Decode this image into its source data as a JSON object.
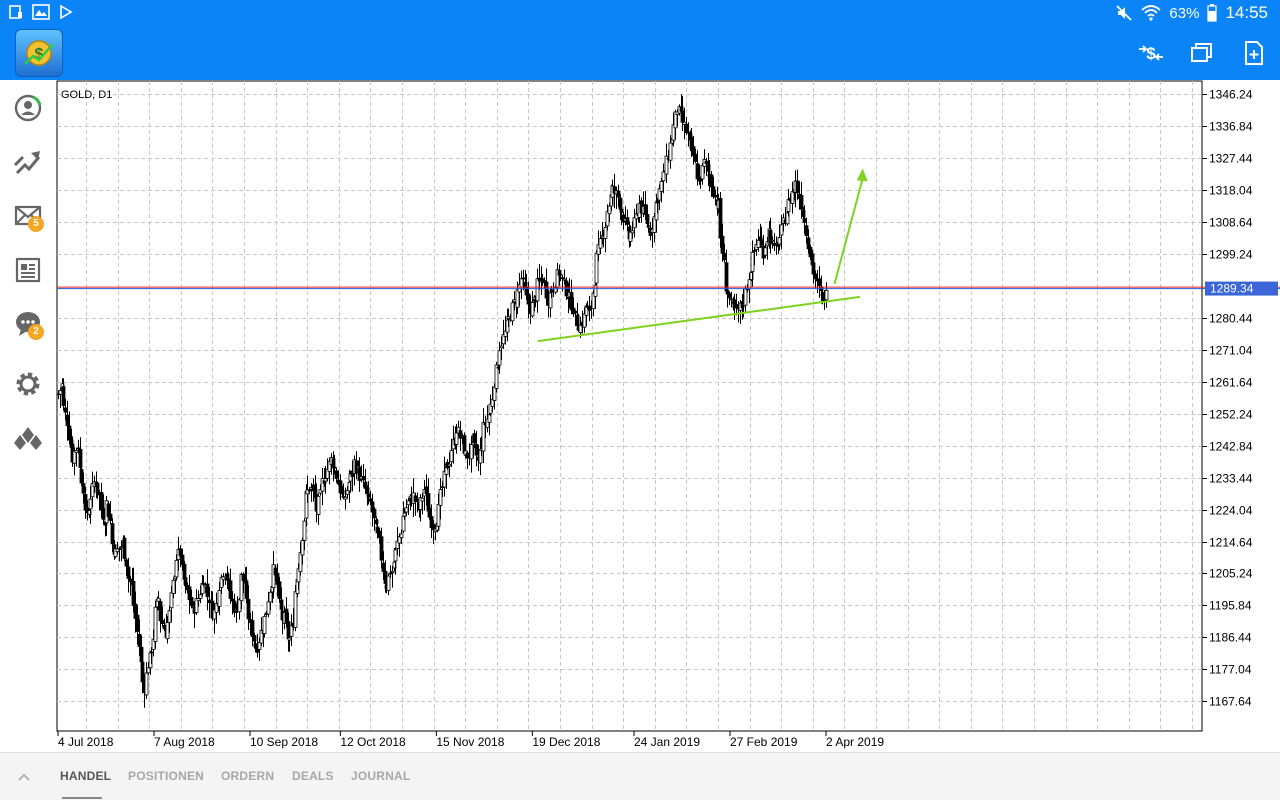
{
  "statusbar": {
    "battery": "63%",
    "time": "14:55"
  },
  "sidebar": {
    "mail_badge": "5",
    "chat_badge": "2"
  },
  "chart": {
    "symbol_label": "GOLD, D1",
    "current_price_label": "1289.34",
    "colors": {
      "grid": "#c8c8c8",
      "candle": "#000000",
      "trendline": "#7ed321",
      "price_line_red": "#e02020",
      "price_line_blue": "#2a58d6",
      "price_tag_bg": "#3a66d8"
    }
  },
  "chart_data": {
    "type": "candlestick",
    "symbol": "GOLD",
    "timeframe": "D1",
    "y_ticks": [
      "1346.24",
      "1336.84",
      "1327.44",
      "1318.04",
      "1308.64",
      "1299.24",
      "1289.34",
      "1280.44",
      "1271.04",
      "1261.64",
      "1252.24",
      "1242.84",
      "1233.44",
      "1224.04",
      "1214.64",
      "1205.24",
      "1195.84",
      "1186.44",
      "1177.04",
      "1167.64"
    ],
    "x_ticks": [
      "4 Jul 2018",
      "7 Aug 2018",
      "10 Sep 2018",
      "12 Oct 2018",
      "15 Nov 2018",
      "19 Dec 2018",
      "24 Jan 2019",
      "27 Feb 2019",
      "2 Apr 2019"
    ],
    "ylim": [
      1158.9,
      1350.4
    ],
    "current_price": 1289.34,
    "trendline": {
      "from": {
        "x": "21 Dec 2018",
        "y": 1273.6
      },
      "to": {
        "x": "14 Apr 2019",
        "y": 1286.6
      }
    },
    "arrow": {
      "from": {
        "x": "5 Apr 2019",
        "y": 1290.4
      },
      "to": {
        "x": "15 Apr 2019",
        "y": 1324.4
      }
    },
    "path": [
      [
        1258,
        1262
      ],
      [
        1254,
        1248
      ],
      [
        1246,
        1236
      ],
      [
        1241,
        1244
      ],
      [
        1236,
        1228
      ],
      [
        1222,
        1226
      ],
      [
        1228,
        1234
      ],
      [
        1232,
        1226
      ],
      [
        1224,
        1220
      ],
      [
        1226,
        1218
      ],
      [
        1214,
        1210
      ],
      [
        1212,
        1214
      ],
      [
        1214,
        1206
      ],
      [
        1204,
        1200
      ],
      [
        1196,
        1184
      ],
      [
        1184,
        1168
      ],
      [
        1172,
        1182
      ],
      [
        1180,
        1190
      ],
      [
        1194,
        1200
      ],
      [
        1192,
        1188
      ],
      [
        1188,
        1196
      ],
      [
        1198,
        1210
      ],
      [
        1210,
        1212
      ],
      [
        1206,
        1198
      ],
      [
        1200,
        1194
      ],
      [
        1194,
        1198
      ],
      [
        1198,
        1204
      ],
      [
        1204,
        1196
      ],
      [
        1198,
        1192
      ],
      [
        1194,
        1200
      ],
      [
        1202,
        1208
      ],
      [
        1206,
        1200
      ],
      [
        1198,
        1194
      ],
      [
        1194,
        1200
      ],
      [
        1204,
        1202
      ],
      [
        1196,
        1186
      ],
      [
        1188,
        1182
      ],
      [
        1184,
        1190
      ],
      [
        1190,
        1196
      ],
      [
        1198,
        1206
      ],
      [
        1206,
        1200
      ],
      [
        1196,
        1190
      ],
      [
        1192,
        1184
      ],
      [
        1186,
        1194
      ],
      [
        1200,
        1212
      ],
      [
        1212,
        1226
      ],
      [
        1228,
        1232
      ],
      [
        1230,
        1226
      ],
      [
        1224,
        1230
      ],
      [
        1232,
        1236
      ],
      [
        1236,
        1240
      ],
      [
        1238,
        1232
      ],
      [
        1232,
        1226
      ],
      [
        1226,
        1232
      ],
      [
        1232,
        1236
      ],
      [
        1238,
        1234
      ],
      [
        1234,
        1230
      ],
      [
        1230,
        1224
      ],
      [
        1226,
        1218
      ],
      [
        1218,
        1212
      ],
      [
        1210,
        1200
      ],
      [
        1202,
        1208
      ],
      [
        1206,
        1214
      ],
      [
        1214,
        1220
      ],
      [
        1222,
        1226
      ],
      [
        1226,
        1228
      ],
      [
        1228,
        1224
      ],
      [
        1224,
        1230
      ],
      [
        1230,
        1222
      ],
      [
        1222,
        1218
      ],
      [
        1220,
        1226
      ],
      [
        1228,
        1236
      ],
      [
        1236,
        1240
      ],
      [
        1242,
        1246
      ],
      [
        1248,
        1244
      ],
      [
        1244,
        1238
      ],
      [
        1240,
        1242
      ],
      [
        1244,
        1238
      ],
      [
        1238,
        1246
      ],
      [
        1248,
        1252
      ],
      [
        1252,
        1260
      ],
      [
        1262,
        1270
      ],
      [
        1272,
        1276
      ],
      [
        1276,
        1282
      ],
      [
        1282,
        1286
      ],
      [
        1286,
        1292
      ],
      [
        1292,
        1286
      ],
      [
        1286,
        1282
      ],
      [
        1284,
        1288
      ],
      [
        1290,
        1292
      ],
      [
        1292,
        1286
      ],
      [
        1286,
        1290
      ],
      [
        1290,
        1294
      ],
      [
        1294,
        1290
      ],
      [
        1290,
        1286
      ],
      [
        1286,
        1282
      ],
      [
        1280,
        1278
      ],
      [
        1278,
        1282
      ],
      [
        1284,
        1280
      ],
      [
        1284,
        1296
      ],
      [
        1298,
        1304
      ],
      [
        1304,
        1310
      ],
      [
        1312,
        1318
      ],
      [
        1318,
        1316
      ],
      [
        1316,
        1310
      ],
      [
        1310,
        1304
      ],
      [
        1304,
        1308
      ],
      [
        1308,
        1314
      ],
      [
        1314,
        1310
      ],
      [
        1310,
        1306
      ],
      [
        1306,
        1312
      ],
      [
        1314,
        1320
      ],
      [
        1320,
        1326
      ],
      [
        1326,
        1334
      ],
      [
        1334,
        1342
      ],
      [
        1342,
        1338
      ],
      [
        1338,
        1334
      ],
      [
        1334,
        1326
      ],
      [
        1328,
        1320
      ],
      [
        1320,
        1326
      ],
      [
        1326,
        1322
      ],
      [
        1322,
        1316
      ],
      [
        1316,
        1312
      ],
      [
        1304,
        1292
      ],
      [
        1290,
        1284
      ],
      [
        1284,
        1282
      ],
      [
        1282,
        1284
      ],
      [
        1284,
        1290
      ],
      [
        1290,
        1298
      ],
      [
        1298,
        1304
      ],
      [
        1304,
        1300
      ],
      [
        1300,
        1306
      ],
      [
        1306,
        1300
      ],
      [
        1300,
        1304
      ],
      [
        1304,
        1310
      ],
      [
        1310,
        1316
      ],
      [
        1316,
        1320
      ],
      [
        1320,
        1314
      ],
      [
        1314,
        1306
      ],
      [
        1306,
        1296
      ],
      [
        1296,
        1290
      ],
      [
        1290,
        1286
      ],
      [
        1286,
        1288
      ]
    ]
  },
  "tabs": [
    "HANDEL",
    "POSITIONEN",
    "ORDERN",
    "DEALS",
    "JOURNAL"
  ]
}
